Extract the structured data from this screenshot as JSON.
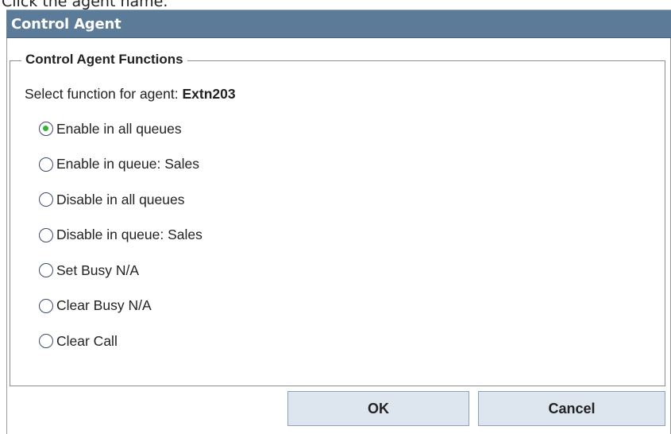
{
  "caption": "Click the agent name.",
  "dialog": {
    "title": "Control Agent",
    "group_label": "Control Agent Functions",
    "prompt_prefix": "Select function for agent:",
    "agent_name": "Extn203",
    "options": [
      {
        "label": "Enable in all queues",
        "checked": true
      },
      {
        "label": "Enable in queue: Sales",
        "checked": false
      },
      {
        "label": "Disable in all queues",
        "checked": false
      },
      {
        "label": "Disable in queue: Sales",
        "checked": false
      },
      {
        "label": "Set Busy N/A",
        "checked": false
      },
      {
        "label": "Clear Busy N/A",
        "checked": false
      },
      {
        "label": "Clear Call",
        "checked": false
      }
    ],
    "ok_label": "OK",
    "cancel_label": "Cancel"
  },
  "colors": {
    "titlebar": "#5b7b98",
    "radio_selected": "#2fb52f",
    "button_face": "#dde6ee"
  }
}
